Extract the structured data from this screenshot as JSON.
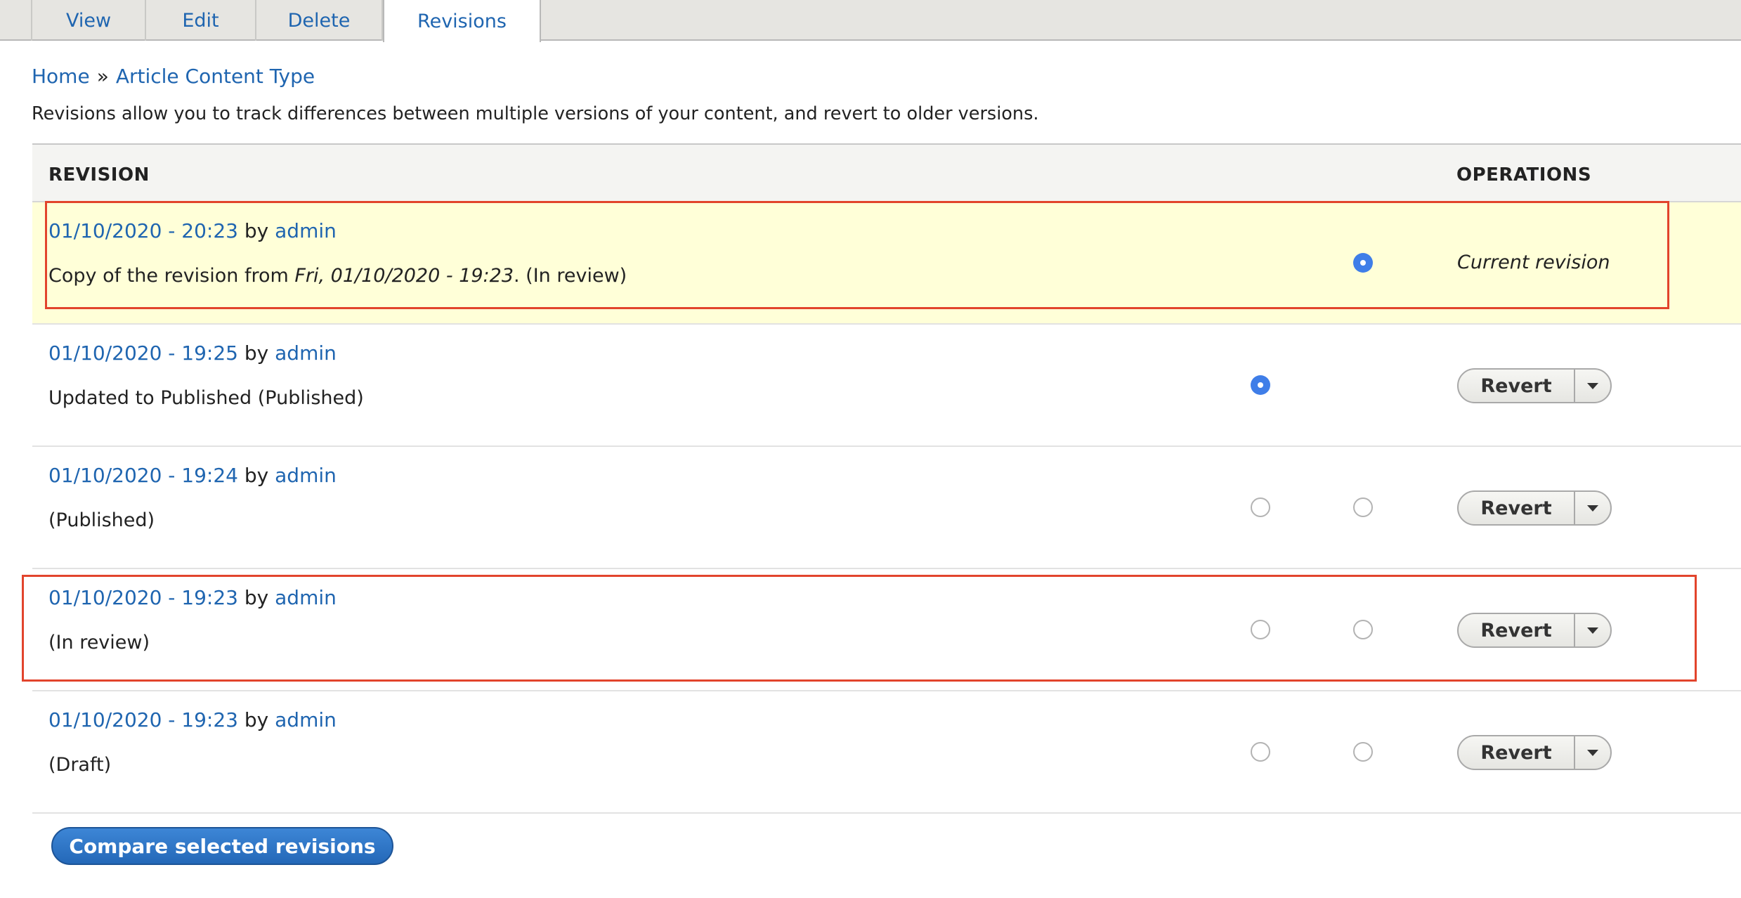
{
  "tabs": [
    {
      "label": "View"
    },
    {
      "label": "Edit"
    },
    {
      "label": "Delete"
    },
    {
      "label": "Revisions"
    }
  ],
  "breadcrumb": {
    "home": "Home",
    "separator": "»",
    "page": "Article Content Type"
  },
  "description": "Revisions allow you to track differences between multiple versions of your content, and revert to older versions.",
  "table": {
    "col_revision": "REVISION",
    "col_operations": "OPERATIONS",
    "rows": [
      {
        "date": "01/10/2020 - 20:23",
        "by": "by",
        "author": "admin",
        "msg_prefix": "Copy of the revision from ",
        "msg_italic": "Fri, 01/10/2020 - 19:23",
        "msg_suffix": ". (In review)",
        "operation": "Current revision"
      },
      {
        "date": "01/10/2020 - 19:25",
        "by": "by",
        "author": "admin",
        "msg": "Updated to Published (Published)",
        "operation": "Revert"
      },
      {
        "date": "01/10/2020 - 19:24",
        "by": "by",
        "author": "admin",
        "msg": "(Published)",
        "operation": "Revert"
      },
      {
        "date": "01/10/2020 - 19:23",
        "by": "by",
        "author": "admin",
        "msg": "(In review)",
        "operation": "Revert"
      },
      {
        "date": "01/10/2020 - 19:23",
        "by": "by",
        "author": "admin",
        "msg": "(Draft)",
        "operation": "Revert"
      }
    ]
  },
  "compare_button": "Compare selected revisions",
  "colors": {
    "link": "#1f65b0",
    "current_row": "#ffffd8",
    "highlight": "#e2442c",
    "radio_checked": "#3f7ee8",
    "primary_button": "#2468b8"
  }
}
